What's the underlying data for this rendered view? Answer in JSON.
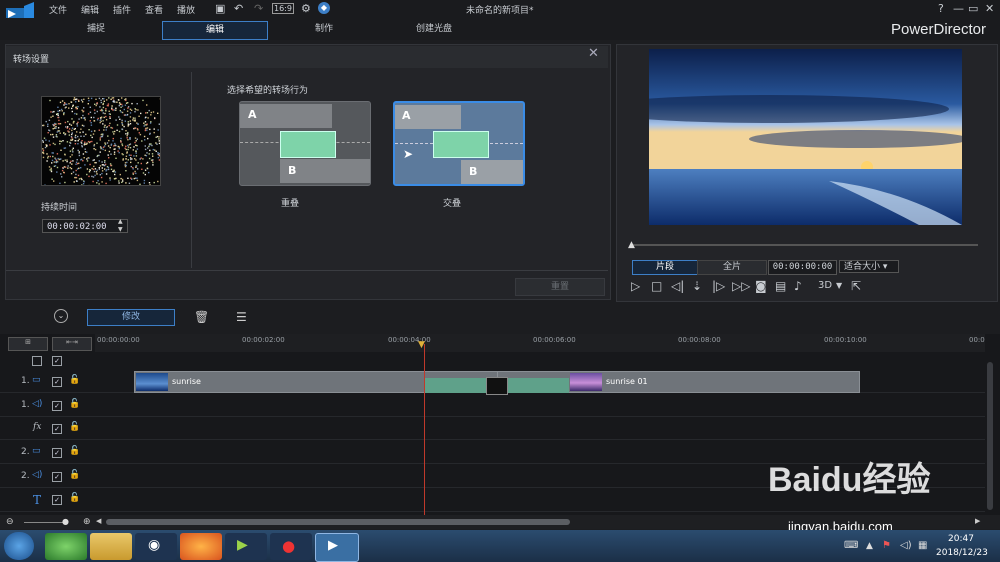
{
  "menu": [
    "文件",
    "编辑",
    "插件",
    "查看",
    "播放"
  ],
  "document_title": "未命名的新项目*",
  "mode_tabs": [
    "捕捉",
    "编辑",
    "制作",
    "创建光盘"
  ],
  "brand": "PowerDirector",
  "transition_panel": {
    "title": "转场设置",
    "duration_label": "持续时间",
    "duration_value": "00:00:02:00",
    "behavior_label": "选择希望的转场行为",
    "options": [
      {
        "label": "重叠",
        "a": "A",
        "b": "B"
      },
      {
        "label": "交叠",
        "a": "A",
        "b": "B"
      }
    ],
    "reset_label": "重置"
  },
  "player": {
    "clip_tab": "片段",
    "full_tab": "全片",
    "timecode": "00:00:00:00",
    "fit_label": "适合大小",
    "mode_3d": "3D"
  },
  "edit_toolbar": {
    "modify_label": "修改"
  },
  "timeline": {
    "ruler": [
      "00:00:00:00",
      "00:00:02:00",
      "00:00:04:00",
      "00:00:06:00",
      "00:00:08:00",
      "00:00:10:00",
      "00:0"
    ],
    "tracks": [
      "1.",
      "1.",
      "fx",
      "2.",
      "2.",
      "T"
    ],
    "clips": [
      "sunrise",
      "sunrise 01"
    ]
  },
  "taskbar": {
    "time": "20:47",
    "date": "2018/12/23"
  },
  "watermark": {
    "text": "Baidu经验",
    "sub": "jingyan.baidu.com"
  }
}
